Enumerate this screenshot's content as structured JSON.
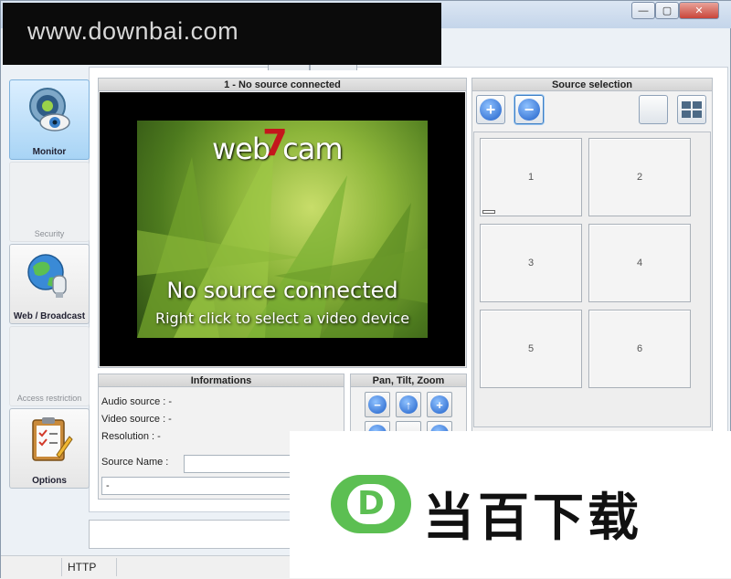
{
  "watermark": {
    "text": "www.downbai.com"
  },
  "window": {
    "controls": {
      "minimize": "—",
      "maximize": "▢",
      "close": "✕"
    }
  },
  "sidebar": {
    "items": [
      {
        "label": "Monitor",
        "icon": "webcam-eye-icon"
      },
      {
        "label": "Security",
        "icon": "none"
      },
      {
        "label": "Web / Broadcast",
        "icon": "globe-icon"
      },
      {
        "label": "Access restriction",
        "icon": "none"
      },
      {
        "label": "Options",
        "icon": "clipboard-checklist-icon"
      }
    ]
  },
  "video_panel": {
    "title": "1 - No source connected",
    "splash": {
      "logo_text": "web",
      "logo_number": "7",
      "logo_suffix": "cam",
      "line1": "No source connected",
      "line2": "Right click to select a video device"
    }
  },
  "informations": {
    "title": "Informations",
    "audio_source": "Audio source : -",
    "video_source": "Video source : -",
    "resolution": "Resolution : -",
    "source_name_label": "Source Name :",
    "source_name_value": "",
    "description_value": "-"
  },
  "ptz": {
    "title": "Pan, Tilt, Zoom",
    "buttons": {
      "zoom_out": "−",
      "up": "↑",
      "zoom_in": "+"
    }
  },
  "source_selection": {
    "title": "Source selection",
    "add_label": "+",
    "remove_label": "−",
    "cells": [
      "1",
      "2",
      "3",
      "4",
      "5",
      "6"
    ]
  },
  "status_bar": {
    "protocol": "HTTP"
  },
  "banner": {
    "logo_letter": "D",
    "text": "当百下载"
  },
  "colors": {
    "accent": "#1f5fc8",
    "brand_green": "#5cbf52",
    "webcam_red": "#c4161c"
  }
}
